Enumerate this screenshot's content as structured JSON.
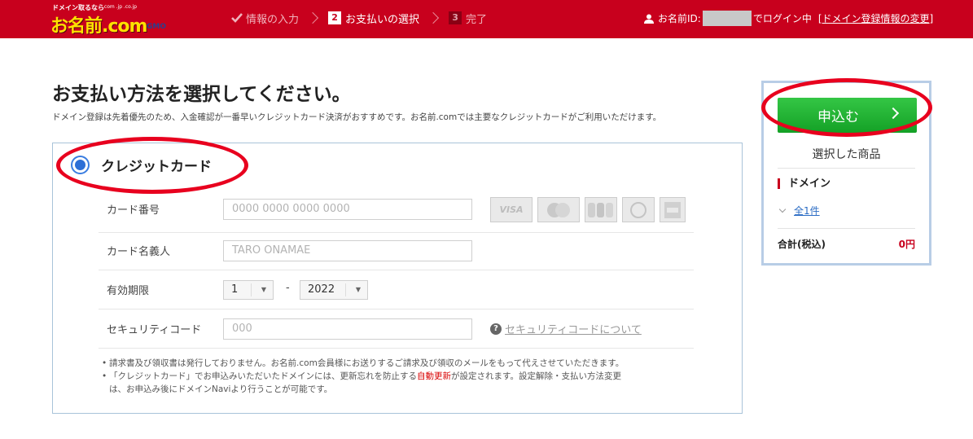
{
  "header": {
    "logo": {
      "tagline": "ドメイン取るなら",
      "tlds": ".com .jp .co.jp",
      "name": "お名前.com",
      "company": "GMO"
    },
    "steps": [
      {
        "label": "情報の入力",
        "state": "done"
      },
      {
        "num": "2",
        "label": "お支払いの選択",
        "state": "current"
      },
      {
        "num": "3",
        "label": "完了",
        "state": "upcoming"
      }
    ],
    "login": {
      "prefix": "お名前ID:",
      "suffix": "でログイン中",
      "link": "[ドメイン登録情報の変更]"
    }
  },
  "main": {
    "title": "お支払い方法を選択してください。",
    "description": "ドメイン登録は先着優先のため、入金確認が一番早いクレジットカード決済がおすすめです。お名前.comでは主要なクレジットカードがご利用いただけます。",
    "payment_method": "クレジットカード",
    "form": {
      "card_number": {
        "label": "カード番号",
        "placeholder": "0000 0000 0000 0000"
      },
      "card_holder": {
        "label": "カード名義人",
        "placeholder": "TARO ONAMAE"
      },
      "expiry": {
        "label": "有効期限",
        "month": "1",
        "separator": "-",
        "year": "2022"
      },
      "security_code": {
        "label": "セキュリティコード",
        "placeholder": "000",
        "help_link": "セキュリティコードについて"
      }
    },
    "card_brands": [
      "VISA",
      "Mastercard",
      "JCB",
      "Diners Club",
      "AMEX"
    ],
    "notes": {
      "line1": "請求書及び領収書は発行しておりません。お名前.com会員様にお送りするご請求及び領収のメールをもって代えさせていただきます。",
      "line2_a": "「クレジットカード」でお申込みいただいたドメインには、更新忘れを防止する",
      "line2_red": "自動更新",
      "line2_b": "が設定されます。設定解除・支払い方法変更",
      "line3": "は、お申込み後にドメインNaviより行うことが可能です。"
    }
  },
  "sidebar": {
    "apply_button": "申込む",
    "selected_title": "選択した商品",
    "domain_heading": "ドメイン",
    "count_link": "全1件",
    "total_label": "合計(税込)",
    "total_value": "0円"
  },
  "colors": {
    "header_red": "#c8001d",
    "accent_green": "#14a126",
    "link_blue": "#2b6cc4",
    "annotation_red": "#e8001e"
  }
}
